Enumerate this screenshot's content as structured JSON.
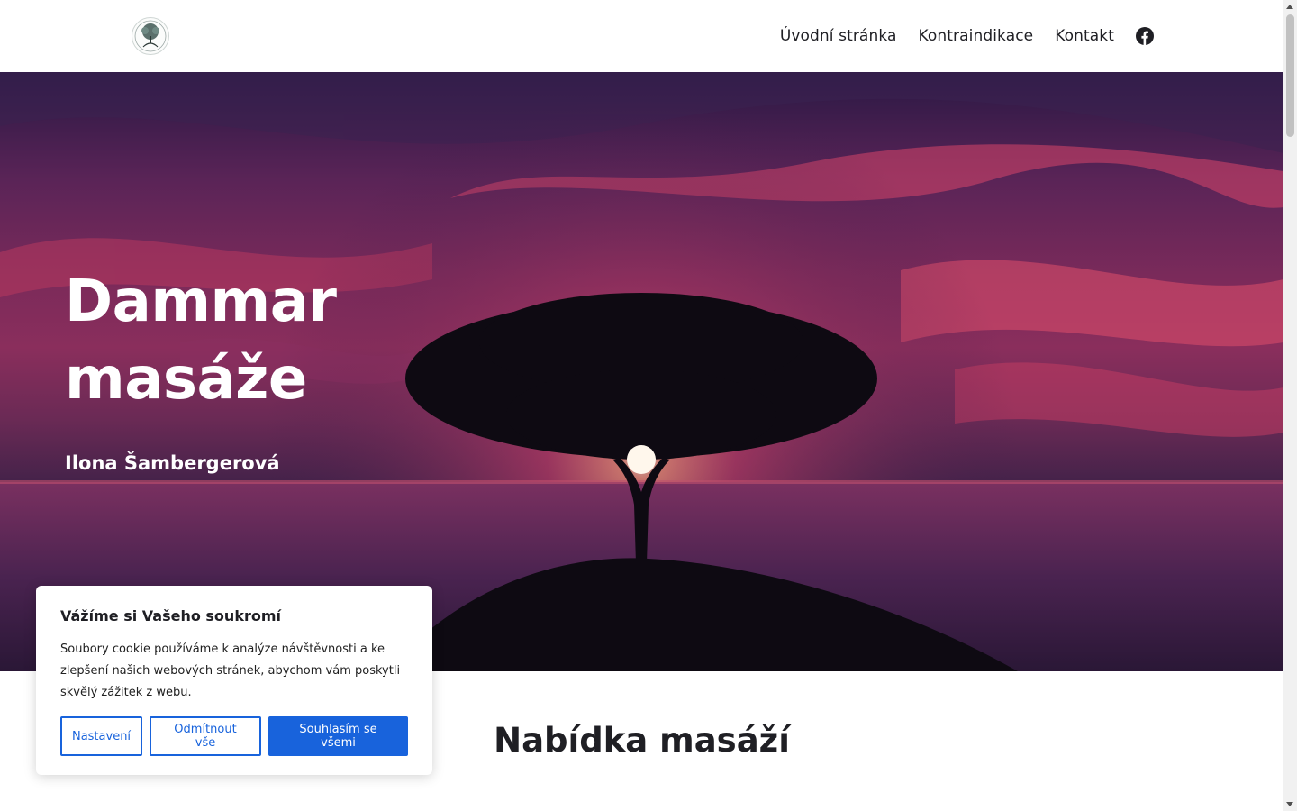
{
  "header": {
    "logo_icon": "tree-of-life-logo-icon",
    "nav": [
      {
        "label": "Úvodní stránka"
      },
      {
        "label": "Kontraindikace"
      },
      {
        "label": "Kontakt"
      }
    ],
    "social_icon": "facebook-icon"
  },
  "hero": {
    "title_line1": "Dammar",
    "title_line2": "masáže",
    "subtitle": "Ilona Šambergerová",
    "image_icon": "tree-sunset-image"
  },
  "main": {
    "section_title": "Nabídka masáží"
  },
  "cookie_banner": {
    "title": "Vážíme si Vašeho soukromí",
    "text": "Soubory cookie používáme k analýze návštěvnosti a ke zlepšení našich webových stránek, abychom vám poskytli skvělý zážitek z webu.",
    "buttons": {
      "settings": "Nastavení",
      "reject": "Odmítnout vše",
      "accept": "Souhlasím se všemi"
    }
  },
  "colors": {
    "accent": "#1863dc",
    "text": "#1f1f24"
  }
}
